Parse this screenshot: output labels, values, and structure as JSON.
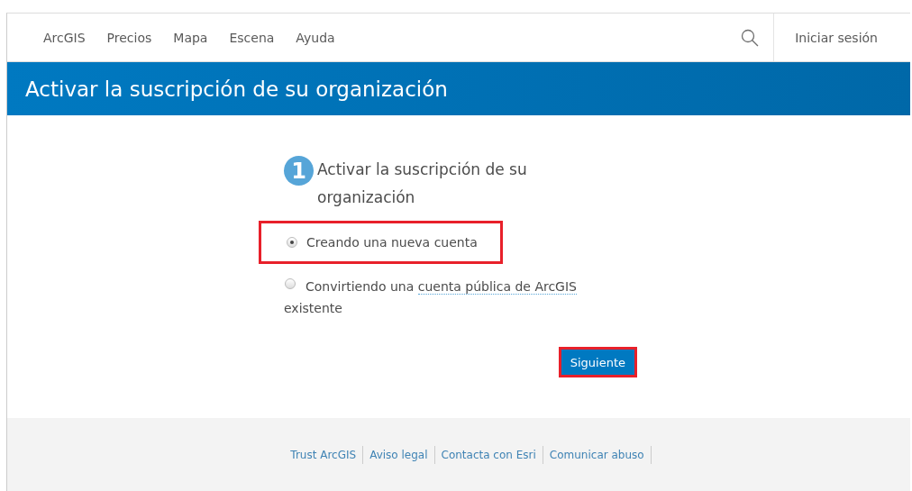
{
  "nav": {
    "links": [
      {
        "label": "ArcGIS"
      },
      {
        "label": "Precios"
      },
      {
        "label": "Mapa"
      },
      {
        "label": "Escena"
      },
      {
        "label": "Ayuda"
      }
    ],
    "sign_in": "Iniciar sesión"
  },
  "banner": {
    "title": "Activar la suscripción de su organización"
  },
  "step": {
    "number": "1",
    "title": "Activar la suscripción de su organización"
  },
  "options": [
    {
      "label": "Creando una nueva cuenta",
      "selected": true,
      "highlighted": true
    },
    {
      "label": "Convirtiendo una",
      "link": "cuenta pública de ArcGIS",
      "label_after": "existente",
      "selected": false,
      "highlighted": false
    }
  ],
  "next_button": {
    "label": "Siguiente",
    "highlighted": true
  },
  "footer": {
    "links": [
      "Trust ArcGIS",
      "Aviso legal",
      "Contacta con Esri",
      "Comunicar abuso"
    ]
  }
}
